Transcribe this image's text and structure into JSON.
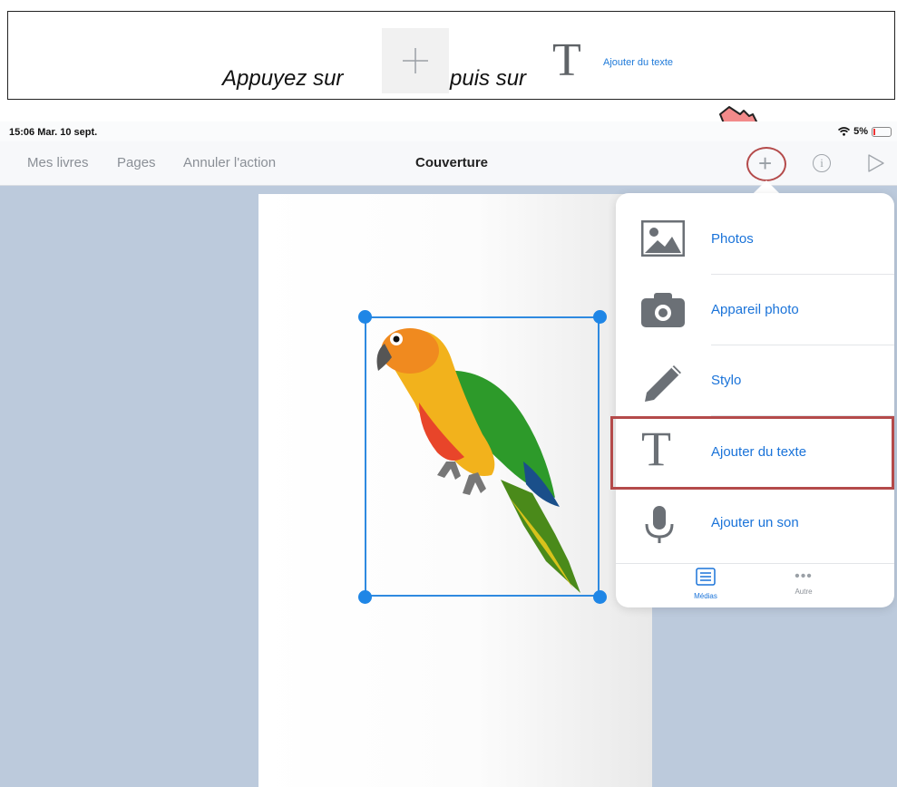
{
  "banner": {
    "text_before": "Appuyez sur",
    "text_middle": "puis sur",
    "add_text_label": "Ajouter du texte",
    "plus_icon": "plus-icon",
    "text_icon": "text-T-icon"
  },
  "status_bar": {
    "time": "15:06  Mar. 10 sept.",
    "battery": "5%"
  },
  "navbar": {
    "my_books": "Mes livres",
    "pages": "Pages",
    "undo": "Annuler l'action",
    "title": "Couverture"
  },
  "menu": {
    "items": [
      {
        "label": "Photos",
        "icon": "photos-icon"
      },
      {
        "label": "Appareil photo",
        "icon": "camera-icon"
      },
      {
        "label": "Stylo",
        "icon": "pen-icon"
      },
      {
        "label": "Ajouter du texte",
        "icon": "text-icon"
      },
      {
        "label": "Ajouter un son",
        "icon": "microphone-icon"
      }
    ],
    "tabs": [
      {
        "label": "Médias",
        "icon": "list-icon"
      },
      {
        "label": "Autre",
        "icon": "more-icon"
      }
    ]
  },
  "colors": {
    "accent": "#1a73d9",
    "highlight": "#b44a4a",
    "canvas": "#bccadc",
    "selection": "#2f8ae0"
  }
}
